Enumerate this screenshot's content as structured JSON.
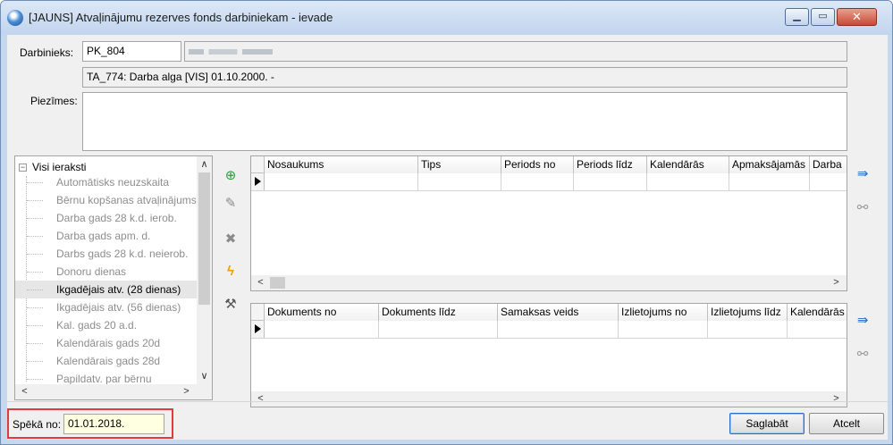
{
  "window": {
    "title": "[JAUNS] Atvaļinājumu rezerves fonds darbiniekam - ievade",
    "minimize_glyph": "▁",
    "maximize_glyph": "▭",
    "close_glyph": "✕"
  },
  "form": {
    "employee_label": "Darbinieks:",
    "employee_code": "PK_804",
    "contract_text": "TA_774: Darba alga [VIS] 01.10.2000. -",
    "notes_label": "Piezīmes:",
    "notes_value": ""
  },
  "tree": {
    "root_label": "Visi ieraksti",
    "root_toggle": "−",
    "items": [
      "Automātisks neuzskaita",
      "Bērnu kopšanas atvaļinājums",
      "Darba gads 28 k.d. ierob.",
      "Darba gads apm. d.",
      "Darbs gads 28 k.d. neierob.",
      "Donoru dienas",
      "Ikgadējais atv. (28 dienas)",
      "Ikgadējais atv. (56 dienas)",
      "Kal. gads 20 a.d.",
      "Kalendārais gads 20d",
      "Kalendārais gads 28d",
      "Papildatv. par bērnu"
    ],
    "selected_index": 6,
    "scroll_up": "∧",
    "scroll_down": "∨",
    "scroll_left": "<",
    "scroll_right": ">"
  },
  "toolbar": {
    "add_glyph": "⊕",
    "edit_glyph": "✎",
    "delete_glyph": "✖",
    "run_glyph": "ϟ",
    "tools_glyph": "⚒"
  },
  "grid_top": {
    "columns": [
      "Nosaukums",
      "Tips",
      "Periods no",
      "Periods līdz",
      "Kalendārās",
      "Apmaksājamās",
      "Darba"
    ],
    "scroll_left": "<",
    "scroll_right": ">"
  },
  "grid_bottom": {
    "columns": [
      "Dokuments no",
      "Dokuments līdz",
      "Samaksas veids",
      "Izlietojums no",
      "Izlietojums līdz",
      "Kalendārās"
    ],
    "scroll_left": "<",
    "scroll_right": ">"
  },
  "side": {
    "export_glyph": "⇛",
    "link_glyph": "⚯"
  },
  "footer": {
    "valid_from_label": "Spēkā no:",
    "valid_from_value": "01.01.2018.",
    "save_label": "Saglabāt",
    "cancel_label": "Atcelt"
  },
  "colors": {
    "accent": "#2b6cc4",
    "highlight_box": "#e23b3b",
    "date_field_bg": "#ffffe1",
    "add_icon": "#2e9a3a",
    "run_icon": "#f0a000"
  }
}
